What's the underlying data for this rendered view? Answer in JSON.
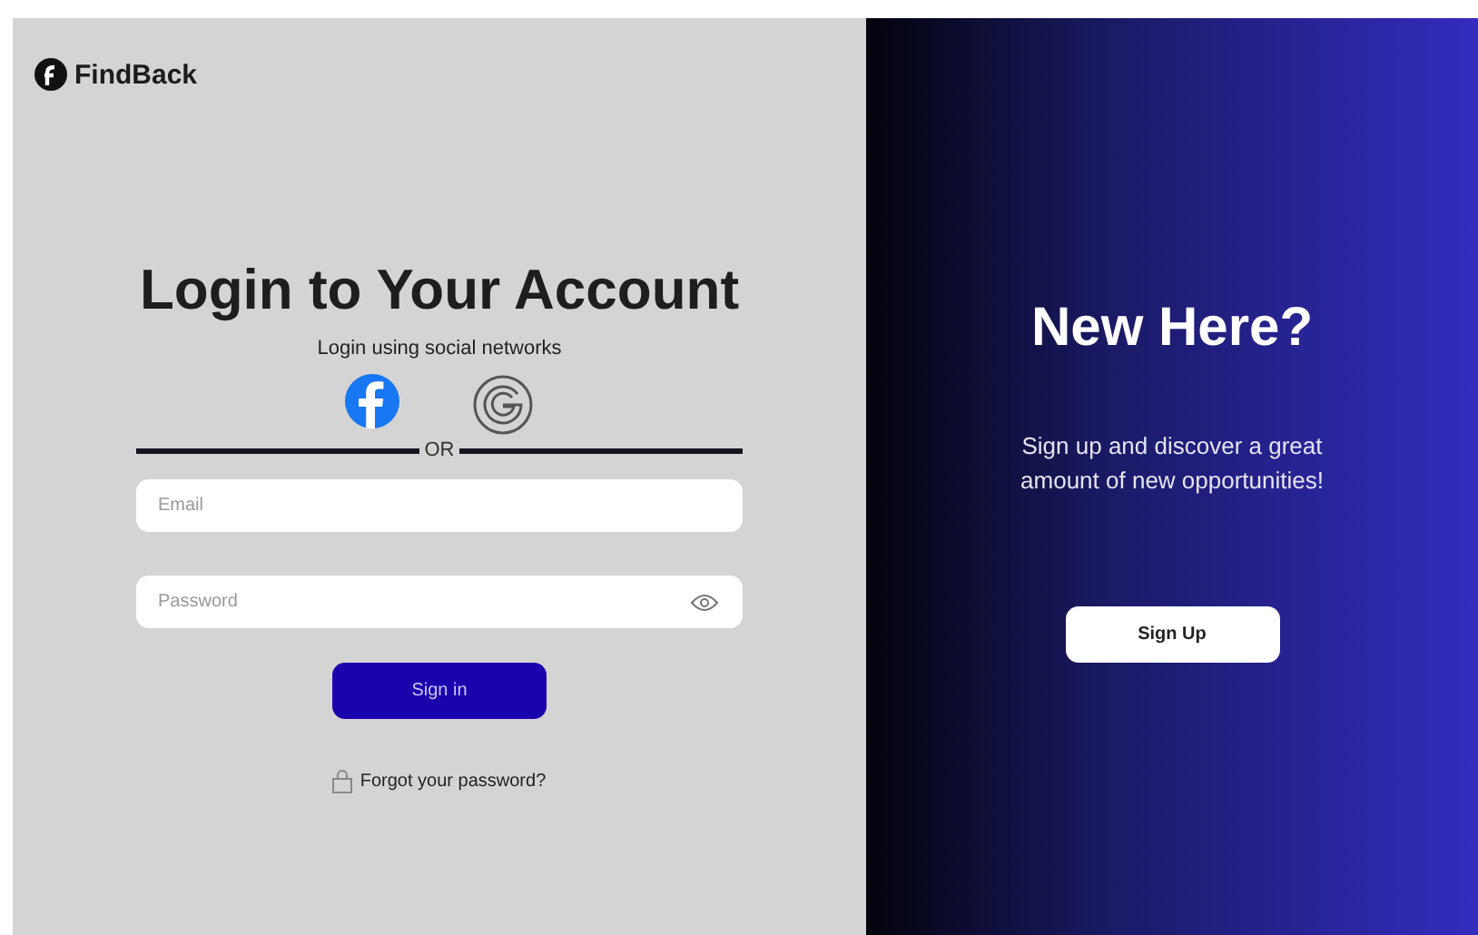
{
  "brand": {
    "name": "FindBack"
  },
  "login": {
    "title": "Login to Your Account",
    "subtitle": "Login using social networks",
    "divider": "OR",
    "email": {
      "placeholder": "Email"
    },
    "password": {
      "placeholder": "Password"
    },
    "submit": "Sign in",
    "forgot": "Forgot your password?"
  },
  "signup": {
    "title": "New Here?",
    "text": "Sign up and discover a great amount of new opportunities!",
    "button": "Sign Up"
  }
}
